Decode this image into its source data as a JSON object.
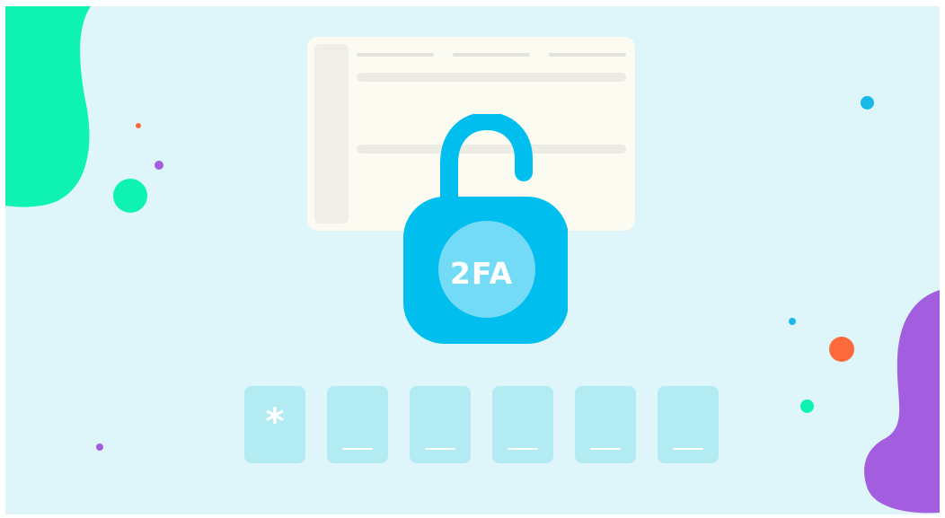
{
  "lock": {
    "badge_text": "2FA",
    "state": "unlocked",
    "color": "#00bfef",
    "badge_color": "#74dbf6"
  },
  "code_input": {
    "digits": [
      {
        "char": "*",
        "filled": true
      },
      {
        "char": "",
        "filled": false
      },
      {
        "char": "",
        "filled": false
      },
      {
        "char": "",
        "filled": false
      },
      {
        "char": "",
        "filled": false
      },
      {
        "char": "",
        "filled": false
      }
    ],
    "box_color": "#b3ebf3"
  },
  "background": {
    "color": "#def6f9",
    "blob_left_color": "#0ff3b0",
    "blob_right_color": "#a35ddf"
  },
  "decorations": {
    "dot_colors": [
      "#ff6a3d",
      "#a35ddf",
      "#0ff3b0",
      "#18b8e8"
    ]
  },
  "card": {
    "background": "#fbfbf1"
  }
}
